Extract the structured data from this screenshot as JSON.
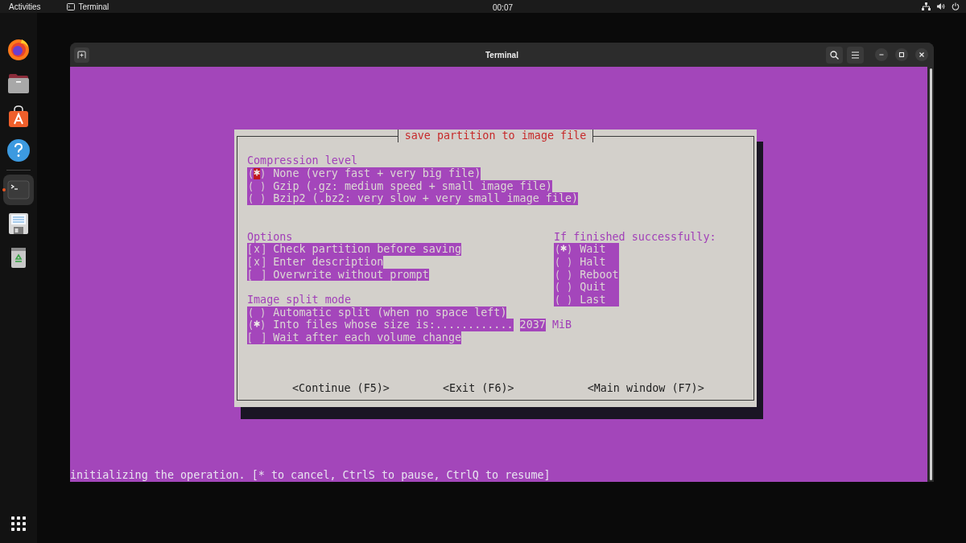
{
  "top_bar": {
    "activities": "Activities",
    "app": "Terminal",
    "clock": "00:07"
  },
  "dock": {
    "items": [
      {
        "kind": "browser",
        "active": false
      },
      {
        "kind": "files",
        "active": false
      },
      {
        "kind": "software",
        "active": false
      },
      {
        "kind": "help",
        "active": false
      },
      {
        "kind": "terminal",
        "active": true
      },
      {
        "kind": "document",
        "active": false
      },
      {
        "kind": "trash",
        "active": false
      }
    ]
  },
  "window": {
    "title": "Terminal"
  },
  "dialog": {
    "title": "save partition to image file",
    "compression": {
      "label": "Compression level",
      "options": [
        {
          "text": "None (very fast + very big file)",
          "selected": true,
          "cursor": true
        },
        {
          "text": "Gzip (.gz: medium speed + small image file)",
          "selected": false,
          "cursor": false
        },
        {
          "text": "Bzip2 (.bz2: very slow + very small image file)",
          "selected": false,
          "cursor": false
        }
      ]
    },
    "options": {
      "label": "Options",
      "items": [
        {
          "text": "Check partition before saving",
          "checked": true
        },
        {
          "text": "Enter description",
          "checked": true
        },
        {
          "text": "Overwrite without prompt",
          "checked": false
        }
      ]
    },
    "split": {
      "label": "Image split mode",
      "items": [
        {
          "kind": "radio",
          "text": "Automatic split (when no space left)",
          "selected": false
        },
        {
          "kind": "radio",
          "text": "Into files whose size is:............",
          "selected": true,
          "value": "2037",
          "unit": "MiB"
        },
        {
          "kind": "checkbox",
          "text": "Wait after each volume change",
          "checked": false
        }
      ]
    },
    "on_success": {
      "label": "If finished successfully:",
      "options": [
        {
          "text": "Wait",
          "selected": true
        },
        {
          "text": "Halt",
          "selected": false
        },
        {
          "text": "Reboot",
          "selected": false
        },
        {
          "text": "Quit",
          "selected": false
        },
        {
          "text": "Last",
          "selected": false
        }
      ]
    },
    "buttons": [
      "<Continue (F5)>",
      "<Exit (F6)>",
      "<Main window (F7)>"
    ]
  },
  "status_line": "initializing the operation. [* to cancel, CtrlS to pause, CtrlQ to resume]"
}
